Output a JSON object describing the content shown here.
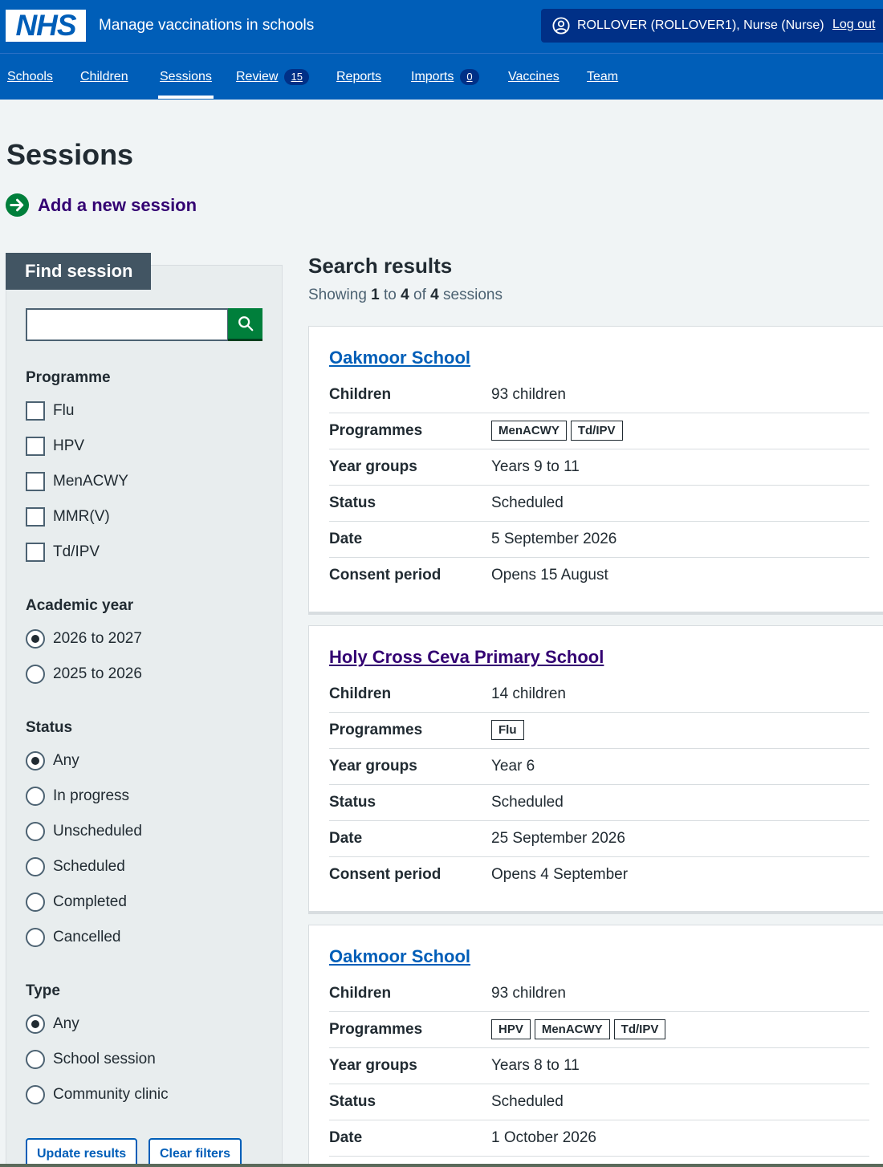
{
  "header": {
    "logo": "NHS",
    "service_name": "Manage vaccinations in schools",
    "account_name": "ROLLOVER (ROLLOVER1), Nurse (Nurse)",
    "logout": "Log out"
  },
  "nav": [
    {
      "label": "Schools"
    },
    {
      "label": "Children"
    },
    {
      "label": "Sessions",
      "active": true
    },
    {
      "label": "Review",
      "count": "15"
    },
    {
      "label": "Reports"
    },
    {
      "label": "Imports",
      "count": "0"
    },
    {
      "label": "Vaccines"
    },
    {
      "label": "Team"
    }
  ],
  "page": {
    "title": "Sessions",
    "add_link": "Add a new session"
  },
  "filters": {
    "heading": "Find session",
    "search_value": "",
    "programme": {
      "legend": "Programme",
      "options": [
        "Flu",
        "HPV",
        "MenACWY",
        "MMR(V)",
        "Td/IPV"
      ]
    },
    "academic_year": {
      "legend": "Academic year",
      "options": [
        "2026 to 2027",
        "2025 to 2026"
      ],
      "selected": "2026 to 2027"
    },
    "status": {
      "legend": "Status",
      "options": [
        "Any",
        "In progress",
        "Unscheduled",
        "Scheduled",
        "Completed",
        "Cancelled"
      ],
      "selected": "Any"
    },
    "type": {
      "legend": "Type",
      "options": [
        "Any",
        "School session",
        "Community clinic"
      ],
      "selected": "Any"
    },
    "update_button": "Update results",
    "clear_button": "Clear filters"
  },
  "results": {
    "title": "Search results",
    "count_prefix": "Showing",
    "from": "1",
    "to_word": "to",
    "to": "4",
    "of_word": "of",
    "total": "4",
    "unit": "sessions",
    "labels": {
      "children": "Children",
      "programmes": "Programmes",
      "year_groups": "Year groups",
      "status": "Status",
      "date": "Date",
      "consent": "Consent period"
    },
    "sessions": [
      {
        "name": "Oakmoor School",
        "children": "93 children",
        "programmes": [
          "MenACWY",
          "Td/IPV"
        ],
        "year_groups": "Years 9 to 11",
        "status": "Scheduled",
        "date": "5 September 2026",
        "consent": "Opens 15 August"
      },
      {
        "name": "Holy Cross Ceva Primary School",
        "visited": true,
        "children": "14 children",
        "programmes": [
          "Flu"
        ],
        "year_groups": "Year 6",
        "status": "Scheduled",
        "date": "25 September 2026",
        "consent": "Opens 4 September"
      },
      {
        "name": "Oakmoor School",
        "children": "93 children",
        "programmes": [
          "HPV",
          "MenACWY",
          "Td/IPV"
        ],
        "year_groups": "Years 8 to 11",
        "status": "Scheduled",
        "date": "1 October 2026"
      }
    ]
  }
}
